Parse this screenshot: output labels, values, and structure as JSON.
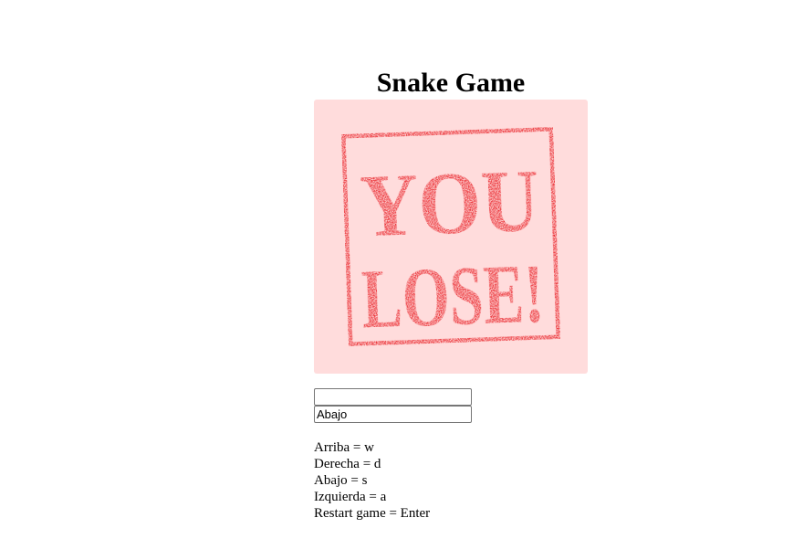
{
  "game": {
    "title": "Snake Game",
    "board_background": "#ffdcdc",
    "stamp": {
      "text_lines": [
        "YOU",
        "LOSE!"
      ],
      "color": "#e8191f"
    }
  },
  "fields": {
    "score_value": "",
    "direction_value": "Abajo"
  },
  "controls": [
    "Arriba = w",
    "Derecha = d",
    "Abajo = s",
    "Izquierda = a",
    "Restart game = Enter"
  ]
}
